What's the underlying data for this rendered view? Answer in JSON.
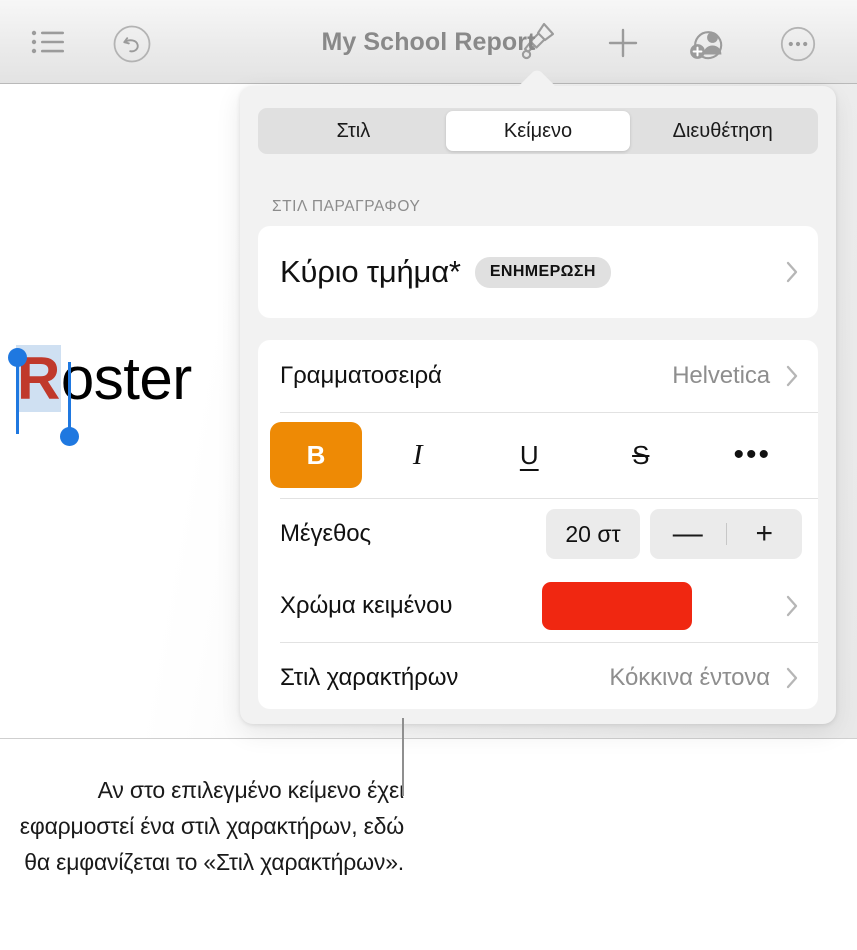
{
  "toolbar": {
    "title": "My School Report",
    "icons": [
      {
        "name": "list-view-icon",
        "label": ""
      },
      {
        "name": "undo-icon",
        "label": ""
      },
      {
        "name": "format-brush-icon",
        "label": ""
      },
      {
        "name": "insert-plus-icon",
        "label": ""
      },
      {
        "name": "collaborate-add-person-icon",
        "label": ""
      },
      {
        "name": "more-options-icon",
        "label": ""
      }
    ]
  },
  "document": {
    "text_selected": "R",
    "text_rest": "oster"
  },
  "panel": {
    "tabs": [
      {
        "label": "Στιλ",
        "active": false
      },
      {
        "label": "Κείμενο",
        "active": true
      },
      {
        "label": "Διευθέτηση",
        "active": false
      }
    ],
    "section_label": "ΣΤΙΛ ΠΑΡΑΓΡΑΦΟΥ",
    "paragraph_style": {
      "name": "Κύριο τμήμα*",
      "badge": "ΕΝΗΜΕΡΩΣΗ"
    },
    "font": {
      "label": "Γραμματοσειρά",
      "value": "Helvetica"
    },
    "format_buttons": [
      {
        "name": "bold-button",
        "glyph": "B",
        "active": true
      },
      {
        "name": "italic-button",
        "glyph": "I",
        "active": false
      },
      {
        "name": "underline-button",
        "glyph": "U",
        "active": false
      },
      {
        "name": "strikethrough-button",
        "glyph": "S",
        "active": false
      },
      {
        "name": "more-format-button",
        "glyph": "•••",
        "active": false
      }
    ],
    "size": {
      "label": "Μέγεθος",
      "value": "20 στ",
      "decrease": "—",
      "increase": "+"
    },
    "text_color": {
      "label": "Χρώμα κειμένου",
      "color": "#F02711"
    },
    "character_style": {
      "label": "Στιλ χαρακτήρων",
      "value": "Κόκκινα έντονα"
    }
  },
  "callout": {
    "caption": "Αν στο επιλεγμένο κείμενο έχει εφαρμοστεί ένα στιλ χαρακτήρων, εδώ θα εμφανίζεται το «Στιλ χαρακτήρων»."
  },
  "colors": {
    "accent_orange": "#EE8A05",
    "text_red": "#F02711",
    "selection_blue": "#1F78E0",
    "panel_bg": "#F2F2F2"
  }
}
